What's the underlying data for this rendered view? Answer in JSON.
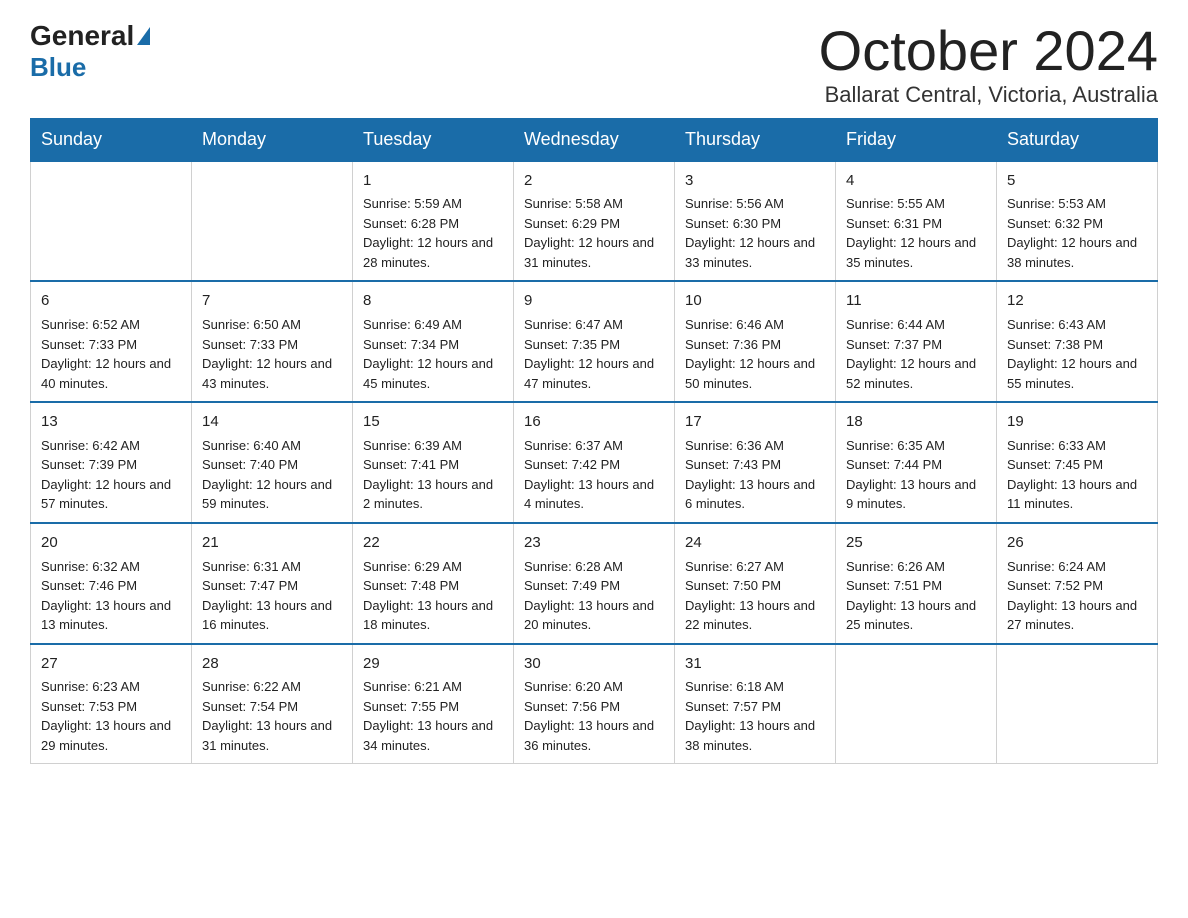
{
  "header": {
    "month_title": "October 2024",
    "location": "Ballarat Central, Victoria, Australia",
    "logo_general": "General",
    "logo_blue": "Blue"
  },
  "days_of_week": [
    "Sunday",
    "Monday",
    "Tuesday",
    "Wednesday",
    "Thursday",
    "Friday",
    "Saturday"
  ],
  "weeks": [
    [
      {
        "day": "",
        "info": ""
      },
      {
        "day": "",
        "info": ""
      },
      {
        "day": "1",
        "info": "Sunrise: 5:59 AM\nSunset: 6:28 PM\nDaylight: 12 hours\nand 28 minutes."
      },
      {
        "day": "2",
        "info": "Sunrise: 5:58 AM\nSunset: 6:29 PM\nDaylight: 12 hours\nand 31 minutes."
      },
      {
        "day": "3",
        "info": "Sunrise: 5:56 AM\nSunset: 6:30 PM\nDaylight: 12 hours\nand 33 minutes."
      },
      {
        "day": "4",
        "info": "Sunrise: 5:55 AM\nSunset: 6:31 PM\nDaylight: 12 hours\nand 35 minutes."
      },
      {
        "day": "5",
        "info": "Sunrise: 5:53 AM\nSunset: 6:32 PM\nDaylight: 12 hours\nand 38 minutes."
      }
    ],
    [
      {
        "day": "6",
        "info": "Sunrise: 6:52 AM\nSunset: 7:33 PM\nDaylight: 12 hours\nand 40 minutes."
      },
      {
        "day": "7",
        "info": "Sunrise: 6:50 AM\nSunset: 7:33 PM\nDaylight: 12 hours\nand 43 minutes."
      },
      {
        "day": "8",
        "info": "Sunrise: 6:49 AM\nSunset: 7:34 PM\nDaylight: 12 hours\nand 45 minutes."
      },
      {
        "day": "9",
        "info": "Sunrise: 6:47 AM\nSunset: 7:35 PM\nDaylight: 12 hours\nand 47 minutes."
      },
      {
        "day": "10",
        "info": "Sunrise: 6:46 AM\nSunset: 7:36 PM\nDaylight: 12 hours\nand 50 minutes."
      },
      {
        "day": "11",
        "info": "Sunrise: 6:44 AM\nSunset: 7:37 PM\nDaylight: 12 hours\nand 52 minutes."
      },
      {
        "day": "12",
        "info": "Sunrise: 6:43 AM\nSunset: 7:38 PM\nDaylight: 12 hours\nand 55 minutes."
      }
    ],
    [
      {
        "day": "13",
        "info": "Sunrise: 6:42 AM\nSunset: 7:39 PM\nDaylight: 12 hours\nand 57 minutes."
      },
      {
        "day": "14",
        "info": "Sunrise: 6:40 AM\nSunset: 7:40 PM\nDaylight: 12 hours\nand 59 minutes."
      },
      {
        "day": "15",
        "info": "Sunrise: 6:39 AM\nSunset: 7:41 PM\nDaylight: 13 hours\nand 2 minutes."
      },
      {
        "day": "16",
        "info": "Sunrise: 6:37 AM\nSunset: 7:42 PM\nDaylight: 13 hours\nand 4 minutes."
      },
      {
        "day": "17",
        "info": "Sunrise: 6:36 AM\nSunset: 7:43 PM\nDaylight: 13 hours\nand 6 minutes."
      },
      {
        "day": "18",
        "info": "Sunrise: 6:35 AM\nSunset: 7:44 PM\nDaylight: 13 hours\nand 9 minutes."
      },
      {
        "day": "19",
        "info": "Sunrise: 6:33 AM\nSunset: 7:45 PM\nDaylight: 13 hours\nand 11 minutes."
      }
    ],
    [
      {
        "day": "20",
        "info": "Sunrise: 6:32 AM\nSunset: 7:46 PM\nDaylight: 13 hours\nand 13 minutes."
      },
      {
        "day": "21",
        "info": "Sunrise: 6:31 AM\nSunset: 7:47 PM\nDaylight: 13 hours\nand 16 minutes."
      },
      {
        "day": "22",
        "info": "Sunrise: 6:29 AM\nSunset: 7:48 PM\nDaylight: 13 hours\nand 18 minutes."
      },
      {
        "day": "23",
        "info": "Sunrise: 6:28 AM\nSunset: 7:49 PM\nDaylight: 13 hours\nand 20 minutes."
      },
      {
        "day": "24",
        "info": "Sunrise: 6:27 AM\nSunset: 7:50 PM\nDaylight: 13 hours\nand 22 minutes."
      },
      {
        "day": "25",
        "info": "Sunrise: 6:26 AM\nSunset: 7:51 PM\nDaylight: 13 hours\nand 25 minutes."
      },
      {
        "day": "26",
        "info": "Sunrise: 6:24 AM\nSunset: 7:52 PM\nDaylight: 13 hours\nand 27 minutes."
      }
    ],
    [
      {
        "day": "27",
        "info": "Sunrise: 6:23 AM\nSunset: 7:53 PM\nDaylight: 13 hours\nand 29 minutes."
      },
      {
        "day": "28",
        "info": "Sunrise: 6:22 AM\nSunset: 7:54 PM\nDaylight: 13 hours\nand 31 minutes."
      },
      {
        "day": "29",
        "info": "Sunrise: 6:21 AM\nSunset: 7:55 PM\nDaylight: 13 hours\nand 34 minutes."
      },
      {
        "day": "30",
        "info": "Sunrise: 6:20 AM\nSunset: 7:56 PM\nDaylight: 13 hours\nand 36 minutes."
      },
      {
        "day": "31",
        "info": "Sunrise: 6:18 AM\nSunset: 7:57 PM\nDaylight: 13 hours\nand 38 minutes."
      },
      {
        "day": "",
        "info": ""
      },
      {
        "day": "",
        "info": ""
      }
    ]
  ]
}
